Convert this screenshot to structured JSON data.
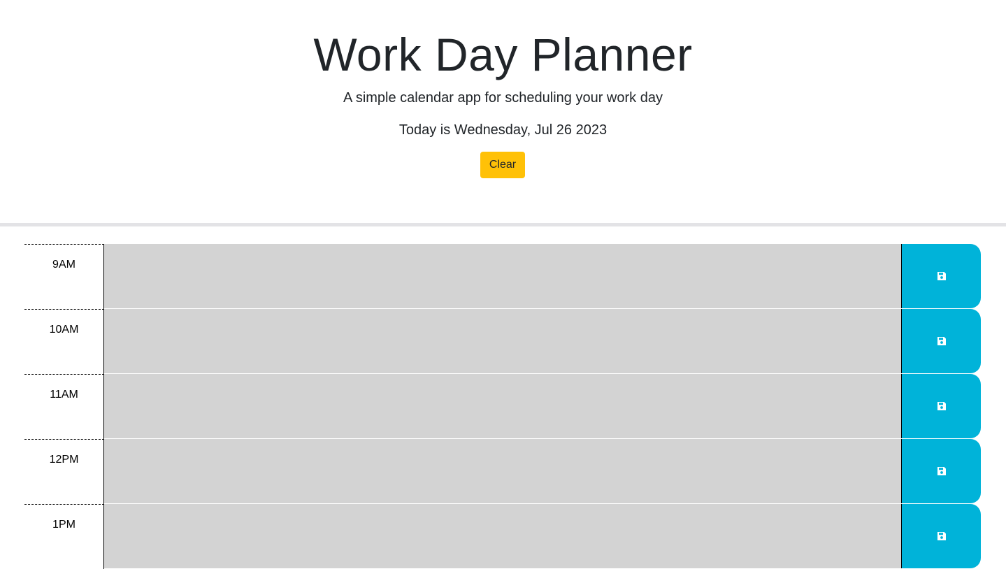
{
  "header": {
    "title": "Work Day Planner",
    "subtitle": "A simple calendar app for scheduling your work day",
    "today": "Today is Wednesday, Jul 26 2023",
    "clear_label": "Clear"
  },
  "timeblocks": [
    {
      "hour": "9AM",
      "text": ""
    },
    {
      "hour": "10AM",
      "text": ""
    },
    {
      "hour": "11AM",
      "text": ""
    },
    {
      "hour": "12PM",
      "text": ""
    },
    {
      "hour": "1PM",
      "text": ""
    }
  ],
  "icons": {
    "save": "floppy-disk-icon"
  },
  "colors": {
    "clear_button": "#ffc107",
    "save_button": "#00b3d9",
    "past_block": "#d3d3d3",
    "divider": "#e3e3e6"
  }
}
